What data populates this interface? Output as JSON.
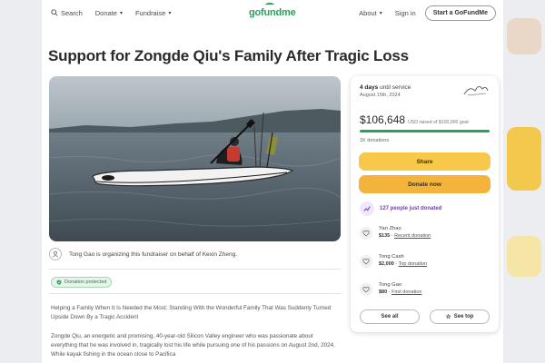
{
  "nav": {
    "search": "Search",
    "donate": "Donate",
    "fundraise": "Fundraise",
    "logo": "gofundme",
    "about": "About",
    "signin": "Sign in",
    "start": "Start a GoFundMe"
  },
  "page_title": "Support for Zongde Qiu's Family After Tragic Loss",
  "organizer": "Tong Gao is organizing this fundraiser on behalf of Kexin Zheng.",
  "badge": "Donation protected",
  "story": {
    "headline": "Helping a Family When It Is Needed the Most: Standing With the Wonderful Family That Was Suddenly Turned Upside Down By a Tragic Accident",
    "body": "Zongde Qiu, an energetic and promising, 40-year-old Silicon Valley engineer who was passionate about everything that he was involved in, tragically lost his life while pursuing one of his passions on August 2nd, 2024. While kayak fishing in the ocean close to Pacifica"
  },
  "card": {
    "days_value": "4 days",
    "days_suffix": "until service",
    "date": "August 15th, 2024",
    "amount": "$106,648",
    "goal": "USD raised of $100,000 goal",
    "progress": 1.0,
    "donors": "1K donations",
    "share": "Share",
    "donate_now": "Donate now",
    "recent": "127 people just donated",
    "donations": [
      {
        "name": "Yan Zhao",
        "amount": "$135",
        "tag": "Recent donation"
      },
      {
        "name": "Tong Cash",
        "amount": "$2,000",
        "tag": "Top donation"
      },
      {
        "name": "Tong Gao",
        "amount": "$80",
        "tag": "First donation"
      }
    ],
    "see_all": "See all",
    "see_top": "See top"
  },
  "colors": {
    "brand": "#2e9e5b",
    "share": "#f7c84a",
    "donate": "#f4b33a",
    "recent": "#6d3fb5"
  },
  "icons": [
    "search-icon",
    "chevron-down-icon",
    "user-icon",
    "shield-check-icon",
    "trend-icon",
    "donation-icon",
    "star-icon"
  ]
}
